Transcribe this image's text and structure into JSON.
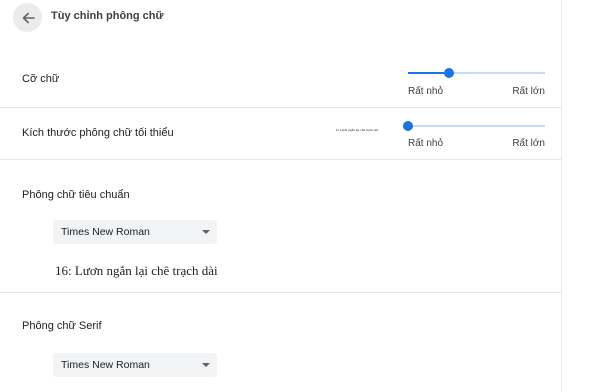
{
  "header": {
    "back_icon": "arrow-back-icon",
    "title": "Tùy chỉnh phông chữ"
  },
  "font_size": {
    "label": "Cỡ chữ",
    "min_label": "Rất nhỏ",
    "max_label": "Rất lớn",
    "value_fraction": 0.3
  },
  "min_font_size": {
    "label": "Kích thước phông chữ tối thiểu",
    "preview_text": "6: Lươn ngắn lại chê trạch dài",
    "min_label": "Rất nhỏ",
    "max_label": "Rất lớn",
    "value_fraction": 0.0
  },
  "standard_font": {
    "title": "Phông chữ tiêu chuẩn",
    "selected": "Times New Roman",
    "sample_text": "16: Lươn ngắn lại chê trạch dài"
  },
  "serif_font": {
    "title": "Phông chữ Serif",
    "selected": "Times New Roman"
  },
  "colors": {
    "accent": "#1a73e8",
    "track": "#c6dafc"
  }
}
